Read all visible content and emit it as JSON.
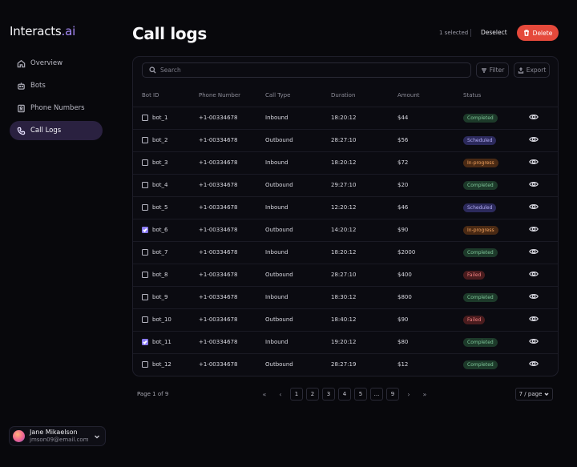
{
  "brand": {
    "name_main": "Interacts",
    "name_suffix": ".ai"
  },
  "sidebar": {
    "items": [
      {
        "label": "Overview",
        "icon": "home-icon",
        "active": false
      },
      {
        "label": "Bots",
        "icon": "bot-icon",
        "active": false
      },
      {
        "label": "Phone Numbers",
        "icon": "phone-book-icon",
        "active": false
      },
      {
        "label": "Call Logs",
        "icon": "phone-icon",
        "active": true
      }
    ],
    "user": {
      "name": "Jane Mikaelson",
      "email": "jmson09@email.com"
    }
  },
  "header": {
    "title": "Call logs",
    "selected_text": "1 selected",
    "deselect_label": "Deselect",
    "delete_label": "Delete"
  },
  "toolbar": {
    "search_placeholder": "Search",
    "filter_label": "Filter",
    "export_label": "Export"
  },
  "table": {
    "columns": [
      "Bot ID",
      "Phone Number",
      "Call Type",
      "Duration",
      "Amount",
      "Status"
    ],
    "rows": [
      {
        "bot_id": "bot_1",
        "phone": "+1-00334678",
        "call_type": "Inbound",
        "duration": "18:20:12",
        "amount": "$44",
        "status": "Completed",
        "checked": false
      },
      {
        "bot_id": "bot_2",
        "phone": "+1-00334678",
        "call_type": "Outbound",
        "duration": "28:27:10",
        "amount": "$56",
        "status": "Scheduled",
        "checked": false
      },
      {
        "bot_id": "bot_3",
        "phone": "+1-00334678",
        "call_type": "Inbound",
        "duration": "18:20:12",
        "amount": "$72",
        "status": "In-progress",
        "checked": false
      },
      {
        "bot_id": "bot_4",
        "phone": "+1-00334678",
        "call_type": "Outbound",
        "duration": "29:27:10",
        "amount": "$20",
        "status": "Completed",
        "checked": false
      },
      {
        "bot_id": "bot_5",
        "phone": "+1-00334678",
        "call_type": "Inbound",
        "duration": "12:20:12",
        "amount": "$46",
        "status": "Scheduled",
        "checked": false
      },
      {
        "bot_id": "bot_6",
        "phone": "+1-00334678",
        "call_type": "Outbound",
        "duration": "14:20:12",
        "amount": "$90",
        "status": "In-progress",
        "checked": true
      },
      {
        "bot_id": "bot_7",
        "phone": "+1-00334678",
        "call_type": "Inbound",
        "duration": "18:20:12",
        "amount": "$2000",
        "status": "Completed",
        "checked": false
      },
      {
        "bot_id": "bot_8",
        "phone": "+1-00334678",
        "call_type": "Outbound",
        "duration": "28:27:10",
        "amount": "$400",
        "status": "Failed",
        "checked": false
      },
      {
        "bot_id": "bot_9",
        "phone": "+1-00334678",
        "call_type": "Inbound",
        "duration": "18:30:12",
        "amount": "$800",
        "status": "Completed",
        "checked": false
      },
      {
        "bot_id": "bot_10",
        "phone": "+1-00334678",
        "call_type": "Outbound",
        "duration": "18:40:12",
        "amount": "$90",
        "status": "Failed",
        "checked": false
      },
      {
        "bot_id": "bot_11",
        "phone": "+1-00334678",
        "call_type": "Inbound",
        "duration": "19:20:12",
        "amount": "$80",
        "status": "Completed",
        "checked": true
      },
      {
        "bot_id": "bot_12",
        "phone": "+1-00334678",
        "call_type": "Outbound",
        "duration": "28:27:19",
        "amount": "$12",
        "status": "Completed",
        "checked": false
      }
    ]
  },
  "status_colors": {
    "Completed": {
      "bg": "#1d3a2a",
      "fg": "#7fc79a"
    },
    "Scheduled": {
      "bg": "#2c2a5c",
      "fg": "#b3adf5"
    },
    "In-progress": {
      "bg": "#4a2a14",
      "fg": "#f2a25e"
    },
    "Failed": {
      "bg": "#4a1c1e",
      "fg": "#f08080"
    }
  },
  "pagination": {
    "page_info": "Page 1 of 9",
    "first": "«",
    "prev": "‹",
    "pages": [
      "1",
      "2",
      "3",
      "4",
      "5",
      "...",
      "9"
    ],
    "next": "›",
    "last": "»",
    "per_page": "7 / page"
  },
  "colors": {
    "accent": "#8b7cf6",
    "danger": "#e5493b",
    "background": "#08080c"
  }
}
